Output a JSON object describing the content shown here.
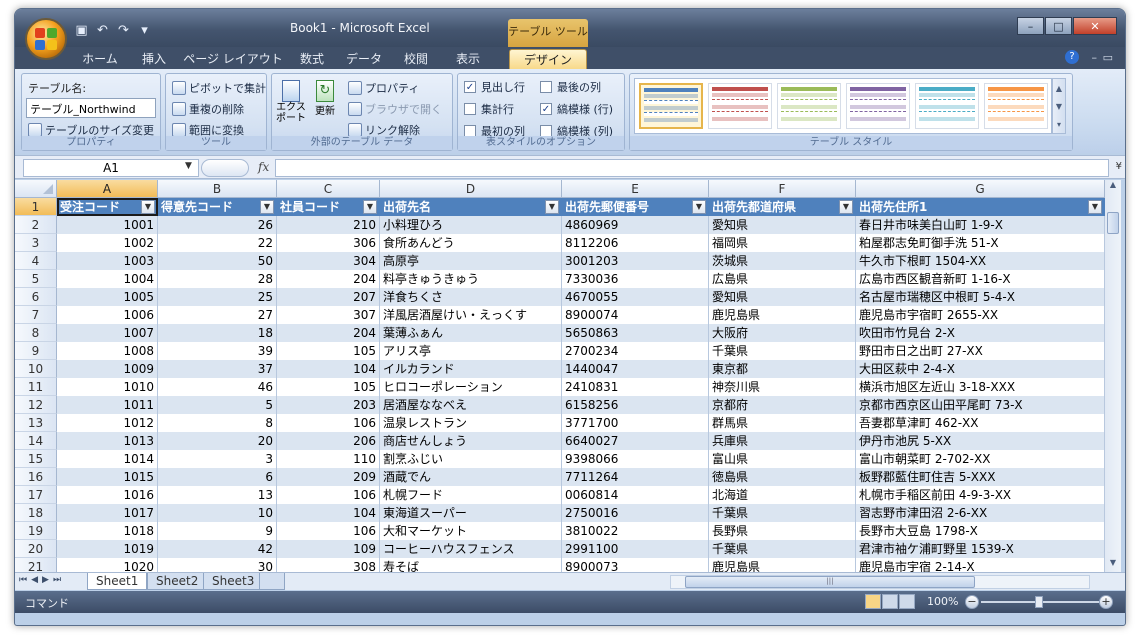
{
  "window": {
    "title": "Book1 - Microsoft Excel",
    "tool_title": "テーブル ツール",
    "controls": [
      "–",
      "□",
      "✕"
    ]
  },
  "ribbon_tabs": [
    "ホーム",
    "挿入",
    "ページ レイアウト",
    "数式",
    "データ",
    "校閲",
    "表示",
    "デザイン"
  ],
  "active_tab": "デザイン",
  "groups": {
    "properties": {
      "label": "プロパティ",
      "table_name_label": "テーブル名:",
      "table_name_value": "テーブル_Northwind",
      "resize_label": "テーブルのサイズ変更"
    },
    "tools": {
      "label": "ツール",
      "pivot": "ピボットで集計",
      "remove_dup": "重複の削除",
      "convert": "範囲に変換"
    },
    "external": {
      "label": "外部のテーブル データ",
      "export": "エクスポート",
      "refresh": "更新",
      "properties": "プロパティ",
      "browser": "ブラウザで開く",
      "unlink": "リンク解除"
    },
    "options": {
      "label": "表スタイルのオプション",
      "items": [
        {
          "text": "見出し行",
          "checked": true
        },
        {
          "text": "最後の列",
          "checked": false
        },
        {
          "text": "集計行",
          "checked": false
        },
        {
          "text": "縞模様 (行)",
          "checked": true
        },
        {
          "text": "最初の列",
          "checked": false
        },
        {
          "text": "縞模様 (列)",
          "checked": false
        }
      ]
    },
    "styles": {
      "label": "テーブル スタイル",
      "swatch_colors": [
        "#4f81bd",
        "#c0504d",
        "#9bbb59",
        "#8064a2",
        "#4bacc6",
        "#f79646"
      ]
    }
  },
  "formula_bar": {
    "name_box": "A1",
    "fx": "fx",
    "value": ""
  },
  "columns": [
    "A",
    "B",
    "C",
    "D",
    "E",
    "F",
    "G"
  ],
  "table_headers": [
    "受注コード",
    "得意先コード",
    "社員コード",
    "出荷先名",
    "出荷先郵便番号",
    "出荷先都道府県",
    "出荷先住所1"
  ],
  "rows": [
    [
      "1001",
      "26",
      "210",
      "小料理ひろ",
      "4860969",
      "愛知県",
      "春日井市味美白山町 1-9-X"
    ],
    [
      "1002",
      "22",
      "306",
      "食所あんどう",
      "8112206",
      "福岡県",
      "粕屋郡志免町御手洗 51-X"
    ],
    [
      "1003",
      "50",
      "304",
      "高原亭",
      "3001203",
      "茨城県",
      "牛久市下根町 1504-XX"
    ],
    [
      "1004",
      "28",
      "204",
      "料亭きゅうきゅう",
      "7330036",
      "広島県",
      "広島市西区観音新町 1-16-X"
    ],
    [
      "1005",
      "25",
      "207",
      "洋食ちくさ",
      "4670055",
      "愛知県",
      "名古屋市瑞穂区中根町 5-4-X"
    ],
    [
      "1006",
      "27",
      "307",
      "洋風居酒屋けい・えっくす",
      "8900074",
      "鹿児島県",
      "鹿児島市宇宿町 2655-XX"
    ],
    [
      "1007",
      "18",
      "204",
      "葉薄ふぁん",
      "5650863",
      "大阪府",
      "吹田市竹見台 2-X"
    ],
    [
      "1008",
      "39",
      "105",
      "アリス亭",
      "2700234",
      "千葉県",
      "野田市日之出町 27-XX"
    ],
    [
      "1009",
      "37",
      "104",
      "イルカランド",
      "1440047",
      "東京都",
      "大田区萩中 2-4-X"
    ],
    [
      "1010",
      "46",
      "105",
      "ヒロコーポレーション",
      "2410831",
      "神奈川県",
      "横浜市旭区左近山 3-18-XXX"
    ],
    [
      "1011",
      "5",
      "203",
      "居酒屋ななべえ",
      "6158256",
      "京都府",
      "京都市西京区山田平尾町 73-X"
    ],
    [
      "1012",
      "8",
      "106",
      "温泉レストラン",
      "3771700",
      "群馬県",
      "吾妻郡草津町 462-XX"
    ],
    [
      "1013",
      "20",
      "206",
      "商店せんしょう",
      "6640027",
      "兵庫県",
      "伊丹市池尻 5-XX"
    ],
    [
      "1014",
      "3",
      "110",
      "割烹ふじい",
      "9398066",
      "富山県",
      "富山市朝菜町 2-702-XX"
    ],
    [
      "1015",
      "6",
      "209",
      "酒蔵でん",
      "7711264",
      "徳島県",
      "板野郡藍住町住吉 5-XXX"
    ],
    [
      "1016",
      "13",
      "106",
      "札幌フード",
      "0060814",
      "北海道",
      "札幌市手稲区前田 4-9-3-XX"
    ],
    [
      "1017",
      "10",
      "104",
      "東海道スーパー",
      "2750016",
      "千葉県",
      "習志野市津田沼 2-6-XX"
    ],
    [
      "1018",
      "9",
      "106",
      "大和マーケット",
      "3810022",
      "長野県",
      "長野市大豆島 1798-X"
    ],
    [
      "1019",
      "42",
      "109",
      "コーヒーハウスフェンス",
      "2991100",
      "千葉県",
      "君津市袖ケ浦町野里 1539-X"
    ],
    [
      "1020",
      "30",
      "308",
      "寿そば",
      "8900073",
      "鹿児島県",
      "鹿児島市宇宿 2-14-X"
    ]
  ],
  "row_numbers": [
    "1",
    "2",
    "3",
    "4",
    "5",
    "6",
    "7",
    "8",
    "9",
    "10",
    "11",
    "12",
    "13",
    "14",
    "15",
    "16",
    "17",
    "18",
    "19",
    "20",
    "21"
  ],
  "sheets": [
    "Sheet1",
    "Sheet2",
    "Sheet3"
  ],
  "active_sheet": "Sheet1",
  "status": {
    "mode": "コマンド",
    "zoom": "100%"
  }
}
